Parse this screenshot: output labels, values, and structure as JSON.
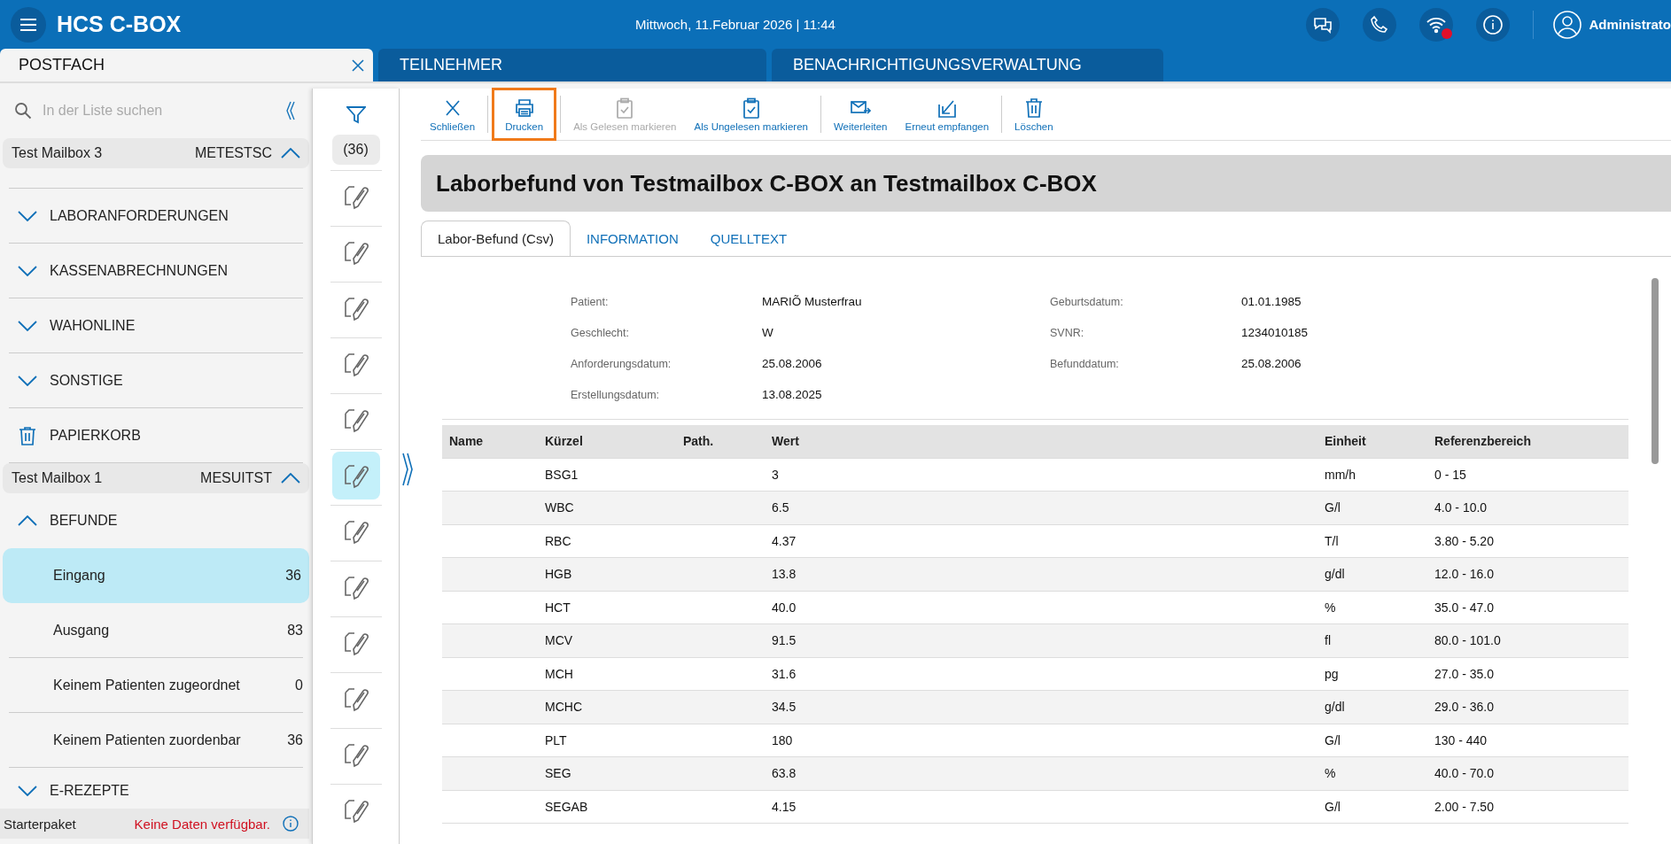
{
  "header": {
    "title": "HCS C-BOX",
    "datetime": "Mittwoch, 11.Februar 2026 | 11:44",
    "wifi_alert": true,
    "user": "Administrato"
  },
  "tabs": [
    {
      "label": "POSTFACH",
      "selected": true,
      "closable": true
    },
    {
      "label": "TEILNEHMER",
      "selected": false,
      "closable": false
    },
    {
      "label": "BENACHRICHTIGUNGSVERWALTUNG",
      "selected": false,
      "closable": false
    }
  ],
  "sidebar": {
    "search": {
      "placeholder": "In der Liste suchen"
    },
    "mailboxes": [
      {
        "name": "Test Mailbox 3",
        "code": "METESTSC",
        "expanded": true,
        "items": [
          {
            "kind": "folder",
            "label": "LABORANFORDERUNGEN",
            "expanded": false
          },
          {
            "kind": "folder",
            "label": "KASSENABRECHNUNGEN",
            "expanded": false
          },
          {
            "kind": "folder",
            "label": "WAHONLINE",
            "expanded": false
          },
          {
            "kind": "folder",
            "label": "SONSTIGE",
            "expanded": false
          },
          {
            "kind": "trash",
            "label": "PAPIERKORB"
          }
        ]
      },
      {
        "name": "Test Mailbox 1",
        "code": "MESUITST",
        "expanded": true,
        "items": [
          {
            "kind": "folder",
            "label": "BEFUNDE",
            "expanded": true,
            "children": [
              {
                "label": "Eingang",
                "count": "36",
                "selected": true
              },
              {
                "label": "Ausgang",
                "count": "83",
                "selected": false
              },
              {
                "label": "Keinem Patienten zugeordnet",
                "count": "0",
                "selected": false
              },
              {
                "label": "Keinem Patienten zuordenbar",
                "count": "36",
                "selected": false
              }
            ]
          },
          {
            "kind": "folder",
            "label": "E-REZEPTE",
            "expanded": false
          }
        ]
      }
    ],
    "status": {
      "label": "Starterpaket",
      "message": "Keine Daten verfügbar."
    }
  },
  "message_list": {
    "count": "(36)",
    "items": [
      {
        "selected": false
      },
      {
        "selected": false
      },
      {
        "selected": false
      },
      {
        "selected": false
      },
      {
        "selected": false
      },
      {
        "selected": true
      },
      {
        "selected": false
      },
      {
        "selected": false
      },
      {
        "selected": false
      },
      {
        "selected": false
      },
      {
        "selected": false
      },
      {
        "selected": false
      }
    ]
  },
  "toolbar": {
    "groups": [
      [
        {
          "label": "Schließen",
          "disabled": false,
          "focused": false
        }
      ],
      [
        {
          "label": "Drucken",
          "disabled": false,
          "focused": true
        }
      ],
      [
        {
          "label": "Als Gelesen markieren",
          "disabled": true,
          "focused": false
        },
        {
          "label": "Als Ungelesen markieren",
          "disabled": false,
          "focused": false
        }
      ],
      [
        {
          "label": "Weiterleiten",
          "disabled": false,
          "focused": false
        },
        {
          "label": "Erneut empfangen",
          "disabled": false,
          "focused": false
        }
      ],
      [
        {
          "label": "Löschen",
          "disabled": false,
          "focused": false
        }
      ]
    ]
  },
  "message": {
    "title": "Laborbefund von Testmailbox C-BOX an Testmailbox C-BOX",
    "tabs": [
      {
        "label": "Labor-Befund (Csv)",
        "selected": true
      },
      {
        "label": "INFORMATION",
        "selected": false
      },
      {
        "label": "QUELLTEXT",
        "selected": false
      }
    ],
    "fields": [
      {
        "label": "Patient:",
        "value": "MARIÕ Musterfrau"
      },
      {
        "label": "Geburtsdatum:",
        "value": "01.01.1985"
      },
      {
        "label": "Geschlecht:",
        "value": "W"
      },
      {
        "label": "SVNR:",
        "value": "1234010185"
      },
      {
        "label": "Anforderungsdatum:",
        "value": "25.08.2006"
      },
      {
        "label": "Befunddatum:",
        "value": "25.08.2006"
      },
      {
        "label": "Erstellungsdatum:",
        "value": "13.08.2025"
      }
    ],
    "table": {
      "columns": [
        "Name",
        "Kürzel",
        "Path.",
        "Wert",
        "Einheit",
        "Referenzbereich"
      ],
      "rows": [
        [
          "",
          "BSG1",
          "",
          "3",
          "mm/h",
          "0 - 15"
        ],
        [
          "",
          "WBC",
          "",
          "6.5",
          "G/l",
          "4.0 - 10.0"
        ],
        [
          "",
          "RBC",
          "",
          "4.37",
          "T/l",
          "3.80 - 5.20"
        ],
        [
          "",
          "HGB",
          "",
          "13.8",
          "g/dl",
          "12.0 - 16.0"
        ],
        [
          "",
          "HCT",
          "",
          "40.0",
          "%",
          "35.0 - 47.0"
        ],
        [
          "",
          "MCV",
          "",
          "91.5",
          "fl",
          "80.0 - 101.0"
        ],
        [
          "",
          "MCH",
          "",
          "31.6",
          "pg",
          "27.0 - 35.0"
        ],
        [
          "",
          "MCHC",
          "",
          "34.5",
          "g/dl",
          "29.0 - 36.0"
        ],
        [
          "",
          "PLT",
          "",
          "180",
          "G/l",
          "130 - 440"
        ],
        [
          "",
          "SEG",
          "",
          "63.8",
          "%",
          "40.0 - 70.0"
        ],
        [
          "",
          "SEGAB",
          "",
          "4.15",
          "G/l",
          "2.00 - 7.50"
        ]
      ]
    }
  }
}
